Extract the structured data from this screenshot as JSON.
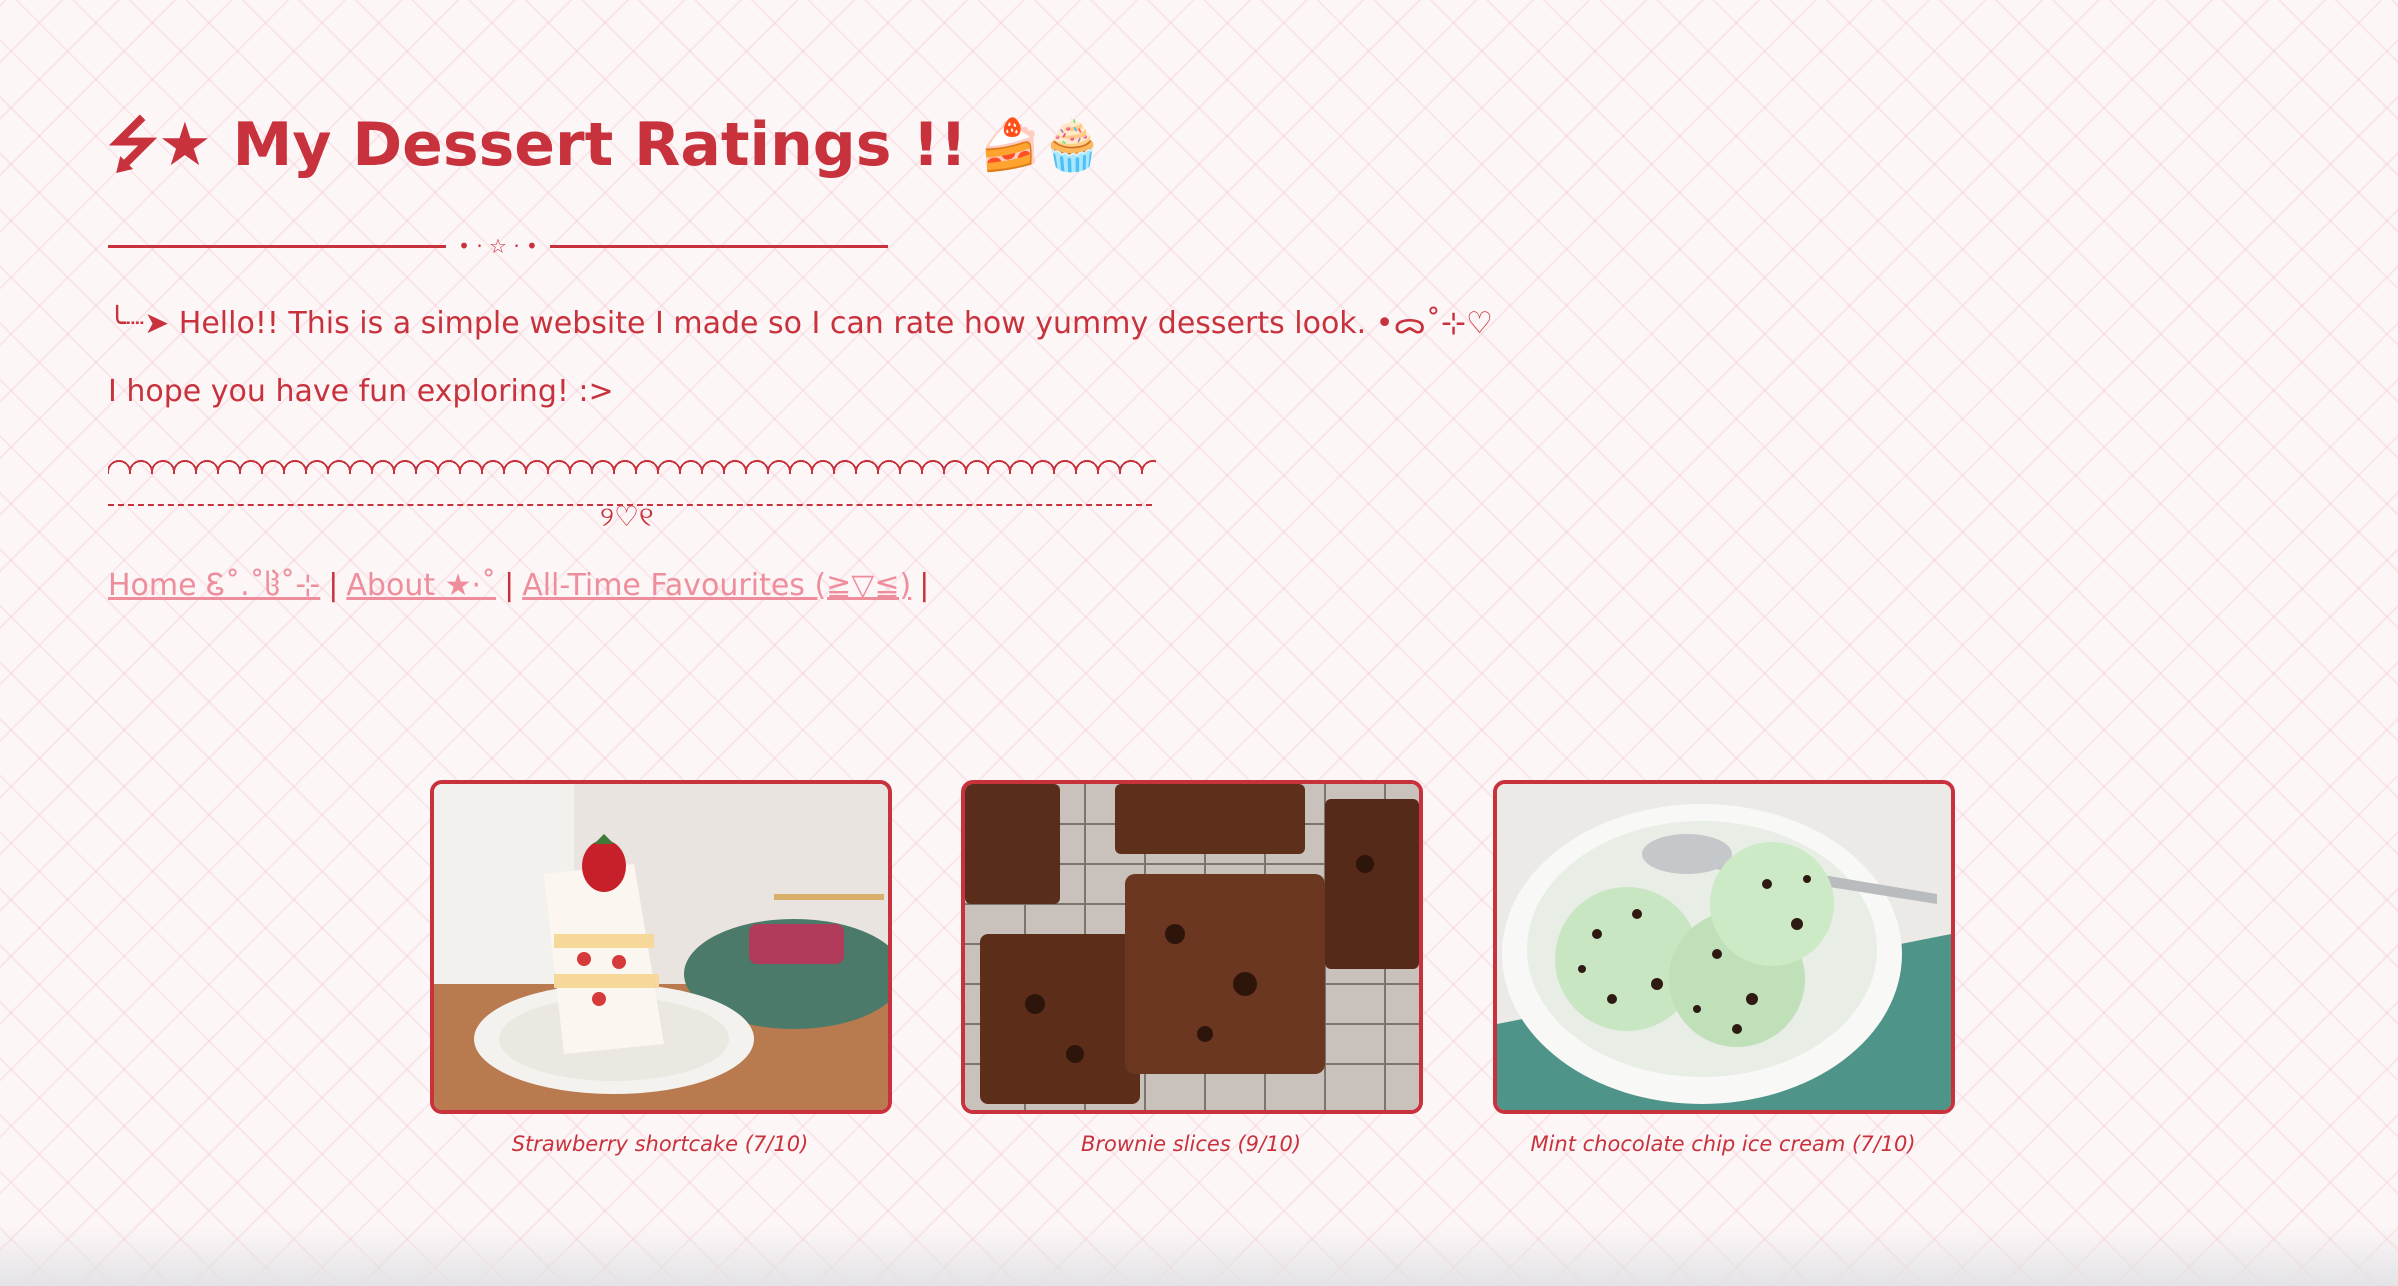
{
  "header": {
    "title": "⭍★ My Dessert Ratings !!",
    "title_icons": "🍰🧁",
    "divider_ornament": "• · ☆ · •"
  },
  "intro": {
    "line1": "╰┈➤ Hello!! This is a simple website I made so I can rate how yummy desserts look. •ᯅ˚⊹♡",
    "line2": "I hope you have fun exploring! :>"
  },
  "decor": {
    "heart": "୨♡୧"
  },
  "nav": {
    "items": [
      {
        "label": "Home Ꮛ˚.˚ჱ˚⊹"
      },
      {
        "label": "About ★·˚"
      },
      {
        "label": "All-Time Favourites (≧▽≦)"
      }
    ],
    "separator": "|"
  },
  "gallery": [
    {
      "caption": "Strawberry shortcake (7/10)",
      "image": "strawberry-shortcake-photo",
      "rating": 7
    },
    {
      "caption": "Brownie slices (9/10)",
      "image": "brownie-slices-photo",
      "rating": 9
    },
    {
      "caption": "Mint chocolate chip ice cream (7/10)",
      "image": "mint-chocolate-chip-ice-cream-photo",
      "rating": 7
    }
  ],
  "colors": {
    "accent": "#c8323d",
    "link": "#ee8e9c",
    "background": "#fdf6f7"
  }
}
